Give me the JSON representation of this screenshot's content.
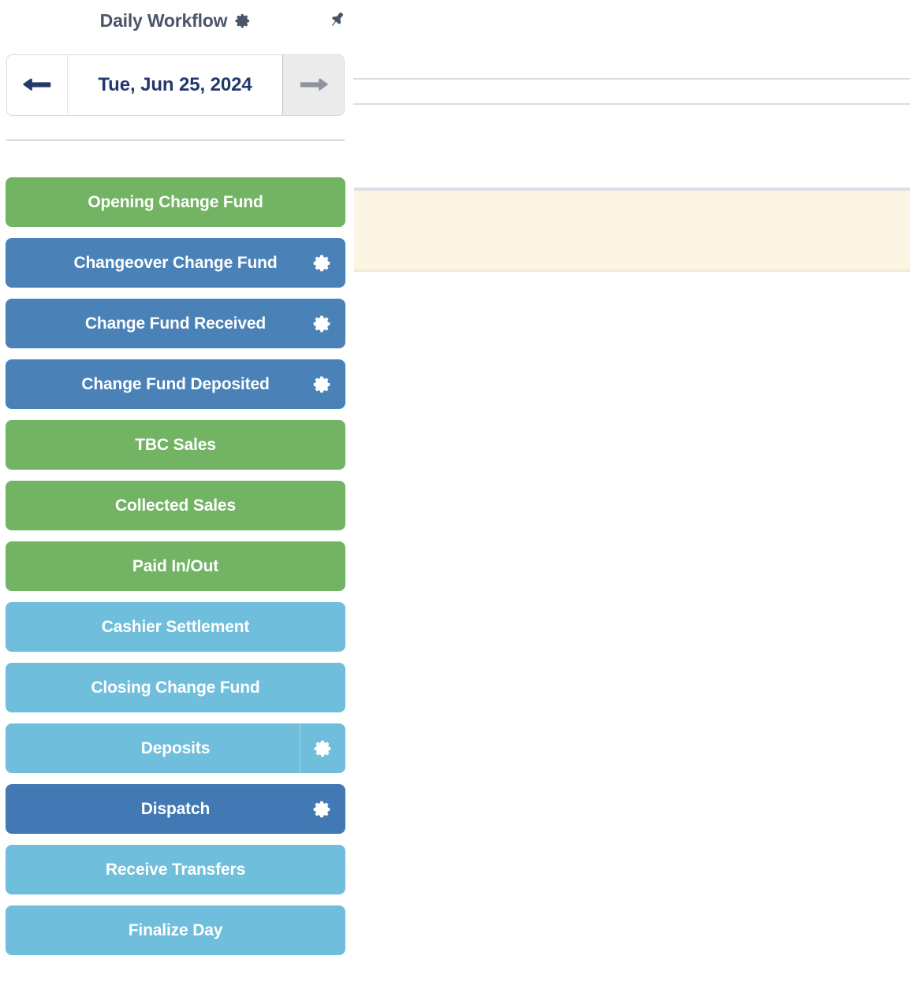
{
  "panel": {
    "title": "Daily Workflow",
    "settings_icon": "gear-icon",
    "pin_icon": "pin-icon"
  },
  "date_nav": {
    "prev_icon": "arrow-left-icon",
    "next_icon": "arrow-right-icon",
    "current_date": "Tue, Jun 25, 2024",
    "next_disabled": true
  },
  "workflow": {
    "steps": [
      {
        "label": "Opening Change Fund",
        "color_class": "c-green",
        "color": "#72b463",
        "gear": false,
        "gear_divider": false
      },
      {
        "label": "Changeover Change Fund",
        "color_class": "c-blue",
        "color": "#4a82b8",
        "gear": true,
        "gear_divider": false
      },
      {
        "label": "Change Fund Received",
        "color_class": "c-blue",
        "color": "#4a82b8",
        "gear": true,
        "gear_divider": false
      },
      {
        "label": "Change Fund Deposited",
        "color_class": "c-blue",
        "color": "#4a82b8",
        "gear": true,
        "gear_divider": false
      },
      {
        "label": "TBC Sales",
        "color_class": "c-green",
        "color": "#72b463",
        "gear": false,
        "gear_divider": false
      },
      {
        "label": "Collected Sales",
        "color_class": "c-green",
        "color": "#72b463",
        "gear": false,
        "gear_divider": false
      },
      {
        "label": "Paid In/Out",
        "color_class": "c-green",
        "color": "#72b463",
        "gear": false,
        "gear_divider": false
      },
      {
        "label": "Cashier Settlement",
        "color_class": "c-lightblue",
        "color": "#6fbedb",
        "gear": false,
        "gear_divider": false
      },
      {
        "label": "Closing Change Fund",
        "color_class": "c-lightblue",
        "color": "#6fbedb",
        "gear": false,
        "gear_divider": false
      },
      {
        "label": "Deposits",
        "color_class": "c-lightblue",
        "color": "#6fbedb",
        "gear": true,
        "gear_divider": true
      },
      {
        "label": "Dispatch",
        "color_class": "c-darkblue",
        "color": "#4279b5",
        "gear": true,
        "gear_divider": false
      },
      {
        "label": "Receive Transfers",
        "color_class": "c-lightblue",
        "color": "#6fbedb",
        "gear": false,
        "gear_divider": false
      },
      {
        "label": "Finalize Day",
        "color_class": "c-lightblue",
        "color": "#6fbedb",
        "gear": false,
        "gear_divider": false
      }
    ]
  },
  "content": {
    "rules": 2,
    "notice_background": "#fcf5e4"
  }
}
